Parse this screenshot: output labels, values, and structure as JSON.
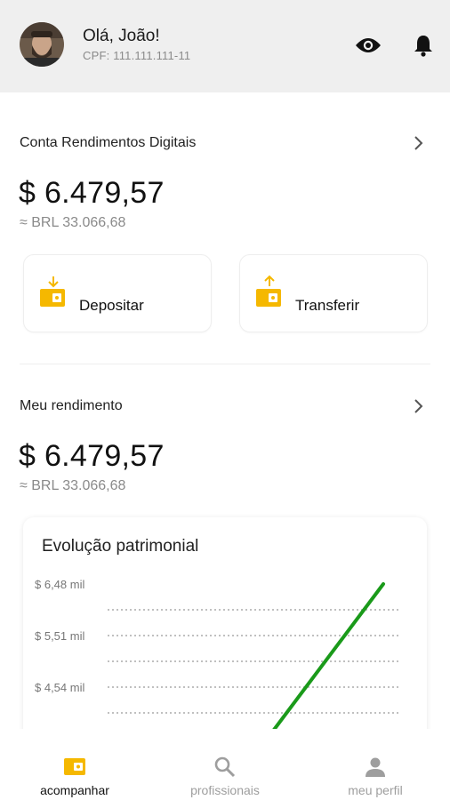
{
  "header": {
    "greeting": "Olá, João!",
    "cpf": "CPF: 111.111.111-11",
    "icons": [
      "avatar",
      "eye-icon",
      "bell-icon"
    ]
  },
  "account": {
    "title": "Conta Rendimentos Digitais",
    "balance": "$ 6.479,57",
    "balance_brl": "≈ BRL 33.066,68"
  },
  "actions": [
    {
      "label": "Depositar",
      "icon": "wallet-deposit-icon"
    },
    {
      "label": "Transferir",
      "icon": "wallet-transfer-icon"
    }
  ],
  "earnings": {
    "title": "Meu rendimento",
    "balance": "$ 6.479,57",
    "balance_brl": "≈ BRL 33.066,68"
  },
  "chart": {
    "title": "Evolução patrimonial"
  },
  "chart_data": {
    "type": "line",
    "title": "Evolução patrimonial",
    "y_tick_labels": [
      "$ 6,48 mil",
      "$ 5,51 mil",
      "$ 4,54 mil"
    ],
    "y_ticks": [
      6480,
      5510,
      4540
    ],
    "gridlines": true,
    "series": [
      {
        "x": [
          0.55,
          1.0
        ],
        "values": [
          3570,
          6480
        ]
      }
    ],
    "colors": {
      "line": "#1a9a1a",
      "grid": "#9a9a9a"
    }
  },
  "bottom_nav": {
    "items": [
      {
        "label": "acompanhar",
        "icon": "wallet-icon",
        "active": true
      },
      {
        "label": "profissionais",
        "icon": "search-icon",
        "active": false
      },
      {
        "label": "meu perfil",
        "icon": "person-icon",
        "active": false
      }
    ]
  },
  "colors": {
    "accent": "#f5b800",
    "header_bg": "#efefef",
    "muted_text": "#8a8a8a",
    "nav_inactive": "#9e9e9e"
  }
}
